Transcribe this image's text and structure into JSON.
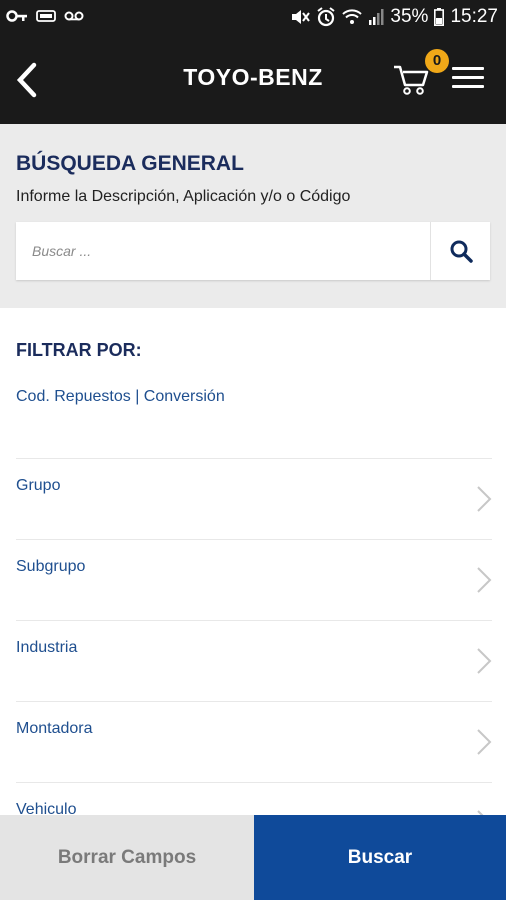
{
  "status_bar": {
    "battery": "35%",
    "time": "15:27",
    "icons": [
      "key-icon",
      "voicemail-icon",
      "tape-icon",
      "mute-icon",
      "alarm-icon",
      "wifi-icon",
      "signal-icon",
      "battery-icon"
    ]
  },
  "app_bar": {
    "title": "TOYO-BENZ",
    "cart_count": "0"
  },
  "search_section": {
    "title": "BÚSQUEDA GENERAL",
    "subtitle": "Informe la Descripción, Aplicación y/o o Código",
    "placeholder": "Buscar ..."
  },
  "filter_section": {
    "title": "FILTRAR POR:",
    "link_1": "Cod. Repuestos",
    "separator": "|",
    "link_2": "Conversión",
    "items": [
      {
        "label": "Grupo"
      },
      {
        "label": "Subgrupo"
      },
      {
        "label": "Industria"
      },
      {
        "label": "Montadora"
      },
      {
        "label": "Vehiculo"
      }
    ]
  },
  "bottom_bar": {
    "clear_label": "Borrar Campos",
    "search_label": "Buscar"
  },
  "colors": {
    "header_bg": "#1a1a1a",
    "accent_blue": "#0f4a9a",
    "title_navy": "#1b2c5c",
    "link_blue": "#1f4f8f",
    "badge": "#f0a818"
  }
}
